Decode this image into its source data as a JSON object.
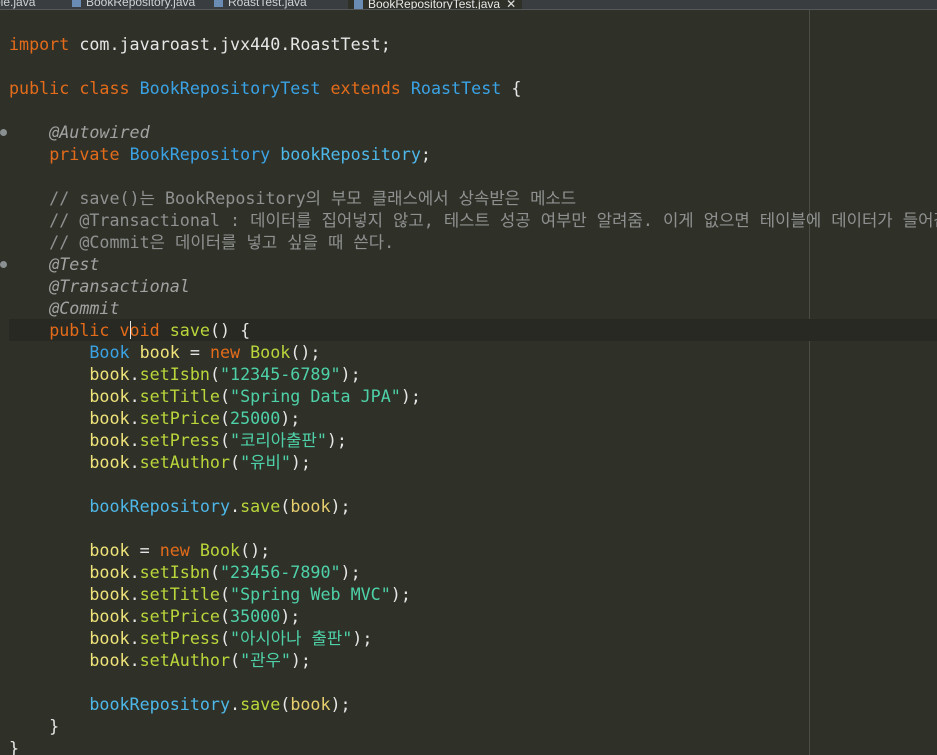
{
  "tabs": [
    {
      "label": "ole.java",
      "active": false
    },
    {
      "label": "BookRepository.java",
      "active": false
    },
    {
      "label": "RoastTest.java",
      "active": false
    },
    {
      "label": "BookRepositoryTest.java",
      "active": true,
      "close": "✕"
    }
  ],
  "code": {
    "lines": [
      [
        {
          "t": "import",
          "c": "kw"
        },
        {
          "t": " com.javaroast.jvx440.RoastTest;",
          "c": ""
        }
      ],
      [],
      [
        {
          "t": "public",
          "c": "kw"
        },
        {
          "t": " ",
          "c": ""
        },
        {
          "t": "class",
          "c": "kw"
        },
        {
          "t": " ",
          "c": ""
        },
        {
          "t": "BookRepositoryTest",
          "c": "ty"
        },
        {
          "t": " ",
          "c": ""
        },
        {
          "t": "extends",
          "c": "kw"
        },
        {
          "t": " ",
          "c": ""
        },
        {
          "t": "RoastTest",
          "c": "ty"
        },
        {
          "t": " {",
          "c": ""
        }
      ],
      [],
      [
        {
          "t": "    ",
          "c": ""
        },
        {
          "t": "@Autowired",
          "c": "an"
        }
      ],
      [
        {
          "t": "    ",
          "c": ""
        },
        {
          "t": "private",
          "c": "kw"
        },
        {
          "t": " ",
          "c": ""
        },
        {
          "t": "BookRepository",
          "c": "ty"
        },
        {
          "t": " ",
          "c": ""
        },
        {
          "t": "bookRepository",
          "c": "fd"
        },
        {
          "t": ";",
          "c": ""
        }
      ],
      [],
      [
        {
          "t": "    // save()는 BookRepository의 부모 클래스에서 상속받은 메소드",
          "c": "cm"
        }
      ],
      [
        {
          "t": "    // @Transactional : 데이터를 집어넣지 않고, 테스트 성공 여부만 알려줌. 이게 없으면 테이블에 데이터가 들어감",
          "c": "cm"
        }
      ],
      [
        {
          "t": "    // @Commit은 데이터를 넣고 싶을 때 쓴다.",
          "c": "cm"
        }
      ],
      [
        {
          "t": "    ",
          "c": ""
        },
        {
          "t": "@Test",
          "c": "an"
        }
      ],
      [
        {
          "t": "    ",
          "c": ""
        },
        {
          "t": "@Transactional",
          "c": "an"
        }
      ],
      [
        {
          "t": "    ",
          "c": ""
        },
        {
          "t": "@Commit",
          "c": "an"
        }
      ],
      [
        {
          "t": "    ",
          "c": ""
        },
        {
          "t": "public",
          "c": "kw"
        },
        {
          "t": " ",
          "c": ""
        },
        {
          "t": "void",
          "c": "kw"
        },
        {
          "t": " ",
          "c": ""
        },
        {
          "t": "save",
          "c": "fn"
        },
        {
          "t": "() {",
          "c": ""
        }
      ],
      [
        {
          "t": "        ",
          "c": ""
        },
        {
          "t": "Book",
          "c": "ty"
        },
        {
          "t": " ",
          "c": ""
        },
        {
          "t": "book",
          "c": "vr"
        },
        {
          "t": " = ",
          "c": ""
        },
        {
          "t": "new",
          "c": "kw"
        },
        {
          "t": " ",
          "c": ""
        },
        {
          "t": "Book",
          "c": "fn"
        },
        {
          "t": "();",
          "c": ""
        }
      ],
      [
        {
          "t": "        ",
          "c": ""
        },
        {
          "t": "book",
          "c": "vr"
        },
        {
          "t": ".",
          "c": ""
        },
        {
          "t": "setIsbn",
          "c": "fn"
        },
        {
          "t": "(",
          "c": ""
        },
        {
          "t": "\"12345-6789\"",
          "c": "st"
        },
        {
          "t": ");",
          "c": ""
        }
      ],
      [
        {
          "t": "        ",
          "c": ""
        },
        {
          "t": "book",
          "c": "vr"
        },
        {
          "t": ".",
          "c": ""
        },
        {
          "t": "setTitle",
          "c": "fn"
        },
        {
          "t": "(",
          "c": ""
        },
        {
          "t": "\"Spring Data JPA\"",
          "c": "st"
        },
        {
          "t": ");",
          "c": ""
        }
      ],
      [
        {
          "t": "        ",
          "c": ""
        },
        {
          "t": "book",
          "c": "vr"
        },
        {
          "t": ".",
          "c": ""
        },
        {
          "t": "setPrice",
          "c": "fn"
        },
        {
          "t": "(",
          "c": ""
        },
        {
          "t": "25000",
          "c": "nu"
        },
        {
          "t": ");",
          "c": ""
        }
      ],
      [
        {
          "t": "        ",
          "c": ""
        },
        {
          "t": "book",
          "c": "vr"
        },
        {
          "t": ".",
          "c": ""
        },
        {
          "t": "setPress",
          "c": "fn"
        },
        {
          "t": "(",
          "c": ""
        },
        {
          "t": "\"코리아출판\"",
          "c": "st"
        },
        {
          "t": ");",
          "c": ""
        }
      ],
      [
        {
          "t": "        ",
          "c": ""
        },
        {
          "t": "book",
          "c": "vr"
        },
        {
          "t": ".",
          "c": ""
        },
        {
          "t": "setAuthor",
          "c": "fn"
        },
        {
          "t": "(",
          "c": ""
        },
        {
          "t": "\"유비\"",
          "c": "st"
        },
        {
          "t": ");",
          "c": ""
        }
      ],
      [],
      [
        {
          "t": "        ",
          "c": ""
        },
        {
          "t": "bookRepository",
          "c": "fd"
        },
        {
          "t": ".",
          "c": ""
        },
        {
          "t": "save",
          "c": "fn"
        },
        {
          "t": "(",
          "c": ""
        },
        {
          "t": "book",
          "c": "pa"
        },
        {
          "t": ");",
          "c": ""
        }
      ],
      [],
      [
        {
          "t": "        ",
          "c": ""
        },
        {
          "t": "book",
          "c": "vr"
        },
        {
          "t": " = ",
          "c": ""
        },
        {
          "t": "new",
          "c": "kw"
        },
        {
          "t": " ",
          "c": ""
        },
        {
          "t": "Book",
          "c": "fn"
        },
        {
          "t": "();",
          "c": ""
        }
      ],
      [
        {
          "t": "        ",
          "c": ""
        },
        {
          "t": "book",
          "c": "vr"
        },
        {
          "t": ".",
          "c": ""
        },
        {
          "t": "setIsbn",
          "c": "fn"
        },
        {
          "t": "(",
          "c": ""
        },
        {
          "t": "\"23456-7890\"",
          "c": "st"
        },
        {
          "t": ");",
          "c": ""
        }
      ],
      [
        {
          "t": "        ",
          "c": ""
        },
        {
          "t": "book",
          "c": "vr"
        },
        {
          "t": ".",
          "c": ""
        },
        {
          "t": "setTitle",
          "c": "fn"
        },
        {
          "t": "(",
          "c": ""
        },
        {
          "t": "\"Spring Web MVC\"",
          "c": "st"
        },
        {
          "t": ");",
          "c": ""
        }
      ],
      [
        {
          "t": "        ",
          "c": ""
        },
        {
          "t": "book",
          "c": "vr"
        },
        {
          "t": ".",
          "c": ""
        },
        {
          "t": "setPrice",
          "c": "fn"
        },
        {
          "t": "(",
          "c": ""
        },
        {
          "t": "35000",
          "c": "nu"
        },
        {
          "t": ");",
          "c": ""
        }
      ],
      [
        {
          "t": "        ",
          "c": ""
        },
        {
          "t": "book",
          "c": "vr"
        },
        {
          "t": ".",
          "c": ""
        },
        {
          "t": "setPress",
          "c": "fn"
        },
        {
          "t": "(",
          "c": ""
        },
        {
          "t": "\"아시아나 출판\"",
          "c": "st"
        },
        {
          "t": ");",
          "c": ""
        }
      ],
      [
        {
          "t": "        ",
          "c": ""
        },
        {
          "t": "book",
          "c": "vr"
        },
        {
          "t": ".",
          "c": ""
        },
        {
          "t": "setAuthor",
          "c": "fn"
        },
        {
          "t": "(",
          "c": ""
        },
        {
          "t": "\"관우\"",
          "c": "st"
        },
        {
          "t": ");",
          "c": ""
        }
      ],
      [],
      [
        {
          "t": "        ",
          "c": ""
        },
        {
          "t": "bookRepository",
          "c": "fd"
        },
        {
          "t": ".",
          "c": ""
        },
        {
          "t": "save",
          "c": "fn"
        },
        {
          "t": "(",
          "c": ""
        },
        {
          "t": "book",
          "c": "pa"
        },
        {
          "t": ");",
          "c": ""
        }
      ],
      [
        {
          "t": "    }",
          "c": ""
        }
      ],
      [
        {
          "t": "}",
          "c": ""
        }
      ]
    ]
  }
}
